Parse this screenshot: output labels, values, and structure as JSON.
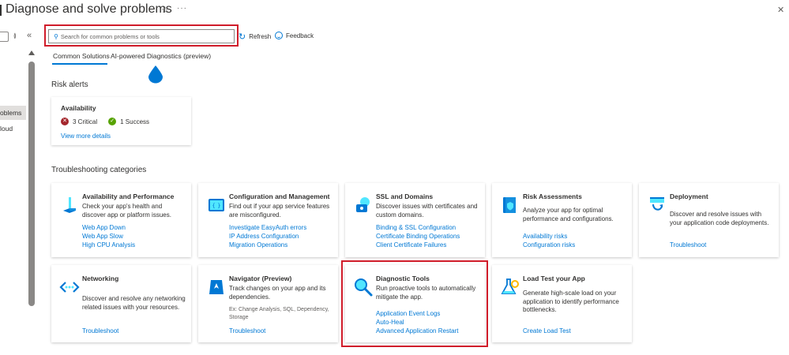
{
  "header": {
    "title": "Diagnose and solve problems",
    "star": "☆",
    "more": "···",
    "close": "✕"
  },
  "nav": {
    "small_label": "≬",
    "collapse": "«",
    "items": [
      {
        "label": "oblems"
      },
      {
        "label": "loud"
      }
    ]
  },
  "toolbar": {
    "search_placeholder": "Search for common problems or tools",
    "refresh_label": "Refresh",
    "feedback_label": "Feedback"
  },
  "tabs": [
    {
      "label": "Common Solutions",
      "active": true
    },
    {
      "label": "AI-powered Diagnostics (preview)",
      "active": false
    }
  ],
  "risk_alerts": {
    "heading": "Risk alerts",
    "card": {
      "title": "Availability",
      "critical_count": "3 Critical",
      "success_count": "1 Success",
      "link": "View more details"
    }
  },
  "troubleshooting": {
    "heading": "Troubleshooting categories",
    "cards": [
      {
        "icon": "availability-icon",
        "title": "Availability and Performance",
        "description": "Check your app's health and discover app or platform issues.",
        "links": [
          "Web App Down",
          "Web App Slow",
          "High CPU Analysis"
        ]
      },
      {
        "icon": "configuration-icon",
        "title": "Configuration and Management",
        "description": "Find out if your app service features are misconfigured.",
        "links": [
          "Investigate EasyAuth errors",
          "IP Address Configuration",
          "Migration Operations"
        ]
      },
      {
        "icon": "ssl-icon",
        "title": "SSL and Domains",
        "description": "Discover issues with certificates and custom domains.",
        "links": [
          "Binding & SSL Configuration",
          "Certificate Binding Operations",
          "Client Certificate Failures"
        ]
      },
      {
        "icon": "risk-assessment-icon",
        "title": "Risk Assessments",
        "description": "Analyze your app for optimal performance and configurations.",
        "links": [
          "Availability risks",
          "Configuration risks"
        ]
      },
      {
        "icon": "deployment-icon",
        "title": "Deployment",
        "description": "Discover and resolve issues with your application code deployments.",
        "links": [
          "Troubleshoot"
        ]
      },
      {
        "icon": "networking-icon",
        "title": "Networking",
        "description": "Discover and resolve any networking related issues with your resources.",
        "links": [
          "Troubleshoot"
        ]
      },
      {
        "icon": "navigator-icon",
        "title": "Navigator (Preview)",
        "description": "Track changes on your app and its dependencies.",
        "note": "Ex: Change Analysis, SQL, Dependency, Storage",
        "links": [
          "Troubleshoot"
        ]
      },
      {
        "icon": "diagnostic-tools-icon",
        "title": "Diagnostic Tools",
        "description": "Run proactive tools to automatically mitigate the app.",
        "links": [
          "Application Event Logs",
          "Auto-Heal",
          "Advanced Application Restart"
        ]
      },
      {
        "icon": "load-test-icon",
        "title": "Load Test your App",
        "description": "Generate high-scale load on your application to identify performance bottlenecks.",
        "links": [
          "Create Load Test"
        ]
      }
    ]
  }
}
